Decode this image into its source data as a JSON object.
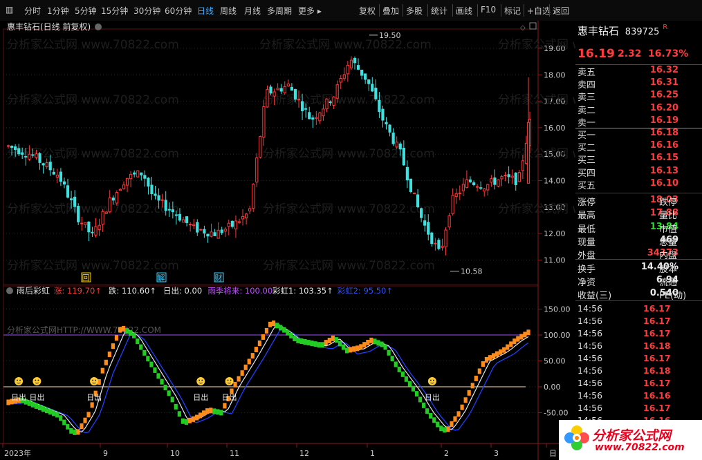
{
  "toolbar": {
    "periods": [
      "分时",
      "1分钟",
      "5分钟",
      "15分钟",
      "30分钟",
      "60分钟",
      "日线",
      "周线",
      "月线",
      "多周期",
      "更多 ▸"
    ],
    "active": "日线",
    "actions": [
      "复权",
      "叠加",
      "多股",
      "统计",
      "画线",
      "F10",
      "标记",
      "+自选",
      "返回"
    ]
  },
  "main": {
    "title": "惠丰钻石(日线 前复权)",
    "watermark": "分析家公式网 www.70822.com",
    "max_label": "19.50",
    "min_label": "10.58",
    "y_ticks": [
      "19.00",
      "18.00",
      "17.00",
      "16.00",
      "15.00",
      "14.00",
      "13.00",
      "12.00",
      "11.00"
    ],
    "events": [
      "回",
      "解",
      "财"
    ]
  },
  "indicator": {
    "name": "雨后彩虹",
    "items": [
      {
        "label": "涨:",
        "value": "119.70",
        "arrow": "↑",
        "color": "#ff3b3b"
      },
      {
        "label": "跌:",
        "value": "110.60",
        "arrow": "↑",
        "color": "#e8e8e8"
      },
      {
        "label": "日出:",
        "value": "0.00",
        "arrow": "",
        "color": "#e8e8e8"
      },
      {
        "label": "雨季将来:",
        "value": "100.00",
        "arrow": "",
        "color": "#c050ff"
      },
      {
        "label": "彩虹1:",
        "value": "103.35",
        "arrow": "↑",
        "color": "#e8e8e8"
      },
      {
        "label": "彩虹2:",
        "value": "95.50",
        "arrow": "↑",
        "color": "#3050ff"
      }
    ],
    "watermark": "分析家公式网HTTP://WWW.70822.COM",
    "y_ticks": [
      "150.00",
      "100.00",
      "50.00",
      "0.00",
      "-50.00"
    ],
    "sun_label": "日出",
    "sun_positions_frac": [
      0.02,
      0.055,
      0.165,
      0.37,
      0.425,
      0.815
    ]
  },
  "xaxis": [
    "2023年",
    "9",
    "10",
    "11",
    "12",
    "1",
    "2",
    "3",
    "日"
  ],
  "stock": {
    "name": "惠丰钻石",
    "code": "839725",
    "flag": "R",
    "price": "16.19",
    "change": "2.32",
    "pct": "16.73%"
  },
  "orderbook": [
    {
      "k": "卖五",
      "v": "16.32"
    },
    {
      "k": "卖四",
      "v": "16.31"
    },
    {
      "k": "卖三",
      "v": "16.25"
    },
    {
      "k": "卖二",
      "v": "16.20"
    },
    {
      "k": "卖一",
      "v": "16.19"
    },
    {
      "k": "买一",
      "v": "16.18"
    },
    {
      "k": "买二",
      "v": "16.16"
    },
    {
      "k": "买三",
      "v": "16.15"
    },
    {
      "k": "买四",
      "v": "16.13"
    },
    {
      "k": "买五",
      "v": "16.10"
    }
  ],
  "stats": [
    {
      "k": "涨停",
      "v": "18.03",
      "c": "red",
      "k2": "跌停"
    },
    {
      "k": "最高",
      "v": "17.88",
      "c": "red",
      "k2": "量比"
    },
    {
      "k": "最低",
      "v": "13.84",
      "c": "green",
      "k2": "市值"
    },
    {
      "k": "现量",
      "v": "469",
      "c": "white",
      "k2": "总量"
    },
    {
      "k": "外盘",
      "v": "34373",
      "c": "red",
      "k2": "内盘"
    },
    {
      "k": "换手",
      "v": "14.40%",
      "c": "white",
      "k2": "股本"
    },
    {
      "k": "净资",
      "v": "6.94",
      "c": "white",
      "k2": "流通"
    },
    {
      "k": "收益(三)",
      "v": "0.540",
      "c": "white",
      "k2": "PE(动)"
    }
  ],
  "ticks": [
    {
      "t": "14:56",
      "p": "16.17"
    },
    {
      "t": "14:56",
      "p": "16.17"
    },
    {
      "t": "14:56",
      "p": "16.17"
    },
    {
      "t": "14:56",
      "p": "16.18"
    },
    {
      "t": "14:56",
      "p": "16.17"
    },
    {
      "t": "14:56",
      "p": "16.18"
    },
    {
      "t": "14:56",
      "p": "16.17"
    },
    {
      "t": "14:56",
      "p": "16.16"
    },
    {
      "t": "14:56",
      "p": "16.17"
    },
    {
      "t": "14:56",
      "p": "16.16"
    },
    {
      "t": "14:56",
      "p": "16.17"
    }
  ],
  "logo": {
    "text": "分析家公式网",
    "url": "www.70822.com"
  },
  "colors": {
    "up": "#ff3b3b",
    "down": "#3fe0e0",
    "grid": "#5a1010",
    "orange": "#ff8c1a",
    "green": "#22cc22",
    "purple": "#a050ff",
    "blue": "#2040ff"
  }
}
